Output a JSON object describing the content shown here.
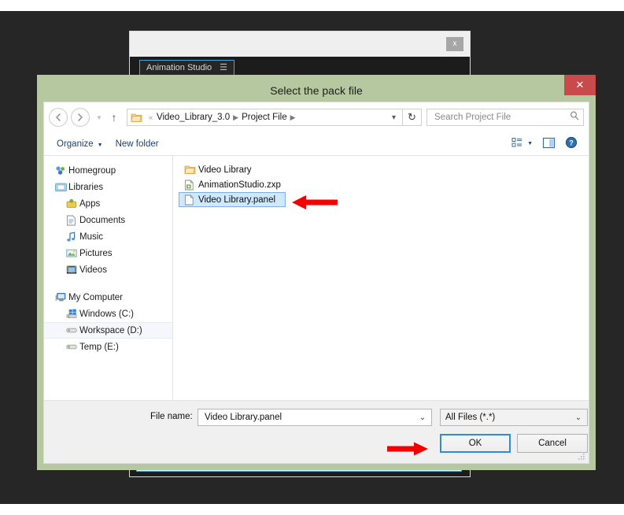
{
  "background_window": {
    "close_label": "x",
    "tab_label": "Animation Studio",
    "tab_menu_icon": "hamburger-icon"
  },
  "dialog": {
    "title": "Select the pack file",
    "close_label": "✕",
    "navigation": {
      "back_icon": "arrow-left-circle-icon",
      "forward_icon": "arrow-right-circle-icon",
      "history_icon": "chevron-down-icon",
      "up_icon": "arrow-up-icon",
      "refresh_icon": "refresh-icon",
      "breadcrumb_folder_icon": "folder-icon",
      "breadcrumb_prefix": "«",
      "breadcrumb": [
        "Video_Library_3.0",
        "Project File"
      ],
      "breadcrumb_separator": "▶",
      "breadcrumb_dropdown_icon": "chevron-down-icon"
    },
    "search": {
      "placeholder": "Search Project File",
      "value": "",
      "icon": "search-icon"
    },
    "commandbar": {
      "organize_label": "Organize",
      "organize_caret": "▼",
      "new_folder_label": "New folder",
      "view_icon": "view-layout-icon",
      "view_caret": "▼",
      "preview_pane_icon": "preview-pane-icon",
      "help_icon": "help-icon"
    },
    "sidebar": {
      "items": [
        {
          "label": "Homegroup",
          "icon": "homegroup-icon",
          "indent": false,
          "selected": false
        },
        {
          "label": "Libraries",
          "icon": "libraries-icon",
          "indent": false,
          "selected": false
        },
        {
          "label": "Apps",
          "icon": "apps-icon",
          "indent": true,
          "selected": false
        },
        {
          "label": "Documents",
          "icon": "documents-icon",
          "indent": true,
          "selected": false
        },
        {
          "label": "Music",
          "icon": "music-icon",
          "indent": true,
          "selected": false
        },
        {
          "label": "Pictures",
          "icon": "pictures-icon",
          "indent": true,
          "selected": false
        },
        {
          "label": "Videos",
          "icon": "videos-icon",
          "indent": true,
          "selected": false
        },
        {
          "label": "My Computer",
          "icon": "computer-icon",
          "indent": false,
          "selected": false,
          "spacer_before": true
        },
        {
          "label": "Windows (C:)",
          "icon": "windows-drive-icon",
          "indent": true,
          "selected": false
        },
        {
          "label": "Workspace (D:)",
          "icon": "drive-icon",
          "indent": true,
          "selected": true
        },
        {
          "label": "Temp (E:)",
          "icon": "drive-icon",
          "indent": true,
          "selected": false
        }
      ]
    },
    "filelist": {
      "items": [
        {
          "label": "Video Library",
          "icon": "folder-icon",
          "selected": false
        },
        {
          "label": "AnimationStudio.zxp",
          "icon": "zxp-file-icon",
          "selected": false
        },
        {
          "label": "Video Library.panel",
          "icon": "generic-file-icon",
          "selected": true
        }
      ]
    },
    "footer": {
      "filename_label": "File name:",
      "filename_value": "Video Library.panel",
      "filename_caret": "⌄",
      "filter_value": "All Files (*.*)",
      "filter_caret": "⌄",
      "ok_label": "OK",
      "cancel_label": "Cancel",
      "resize_grip_icon": "resize-grip-icon"
    }
  },
  "annotations": [
    {
      "name": "arrow-pointing-to-selected-file",
      "direction": "left"
    },
    {
      "name": "arrow-pointing-to-ok-button",
      "direction": "right"
    }
  ],
  "colors": {
    "dialog_frame": "#b6c8a0",
    "close_button": "#c84a4a",
    "selection": "#cde8ff",
    "selection_border": "#7dafe0",
    "focus_ring": "#2f8ad8",
    "annotation_red": "#f40000",
    "desktop": "#262626",
    "link_blue": "#21416b"
  }
}
